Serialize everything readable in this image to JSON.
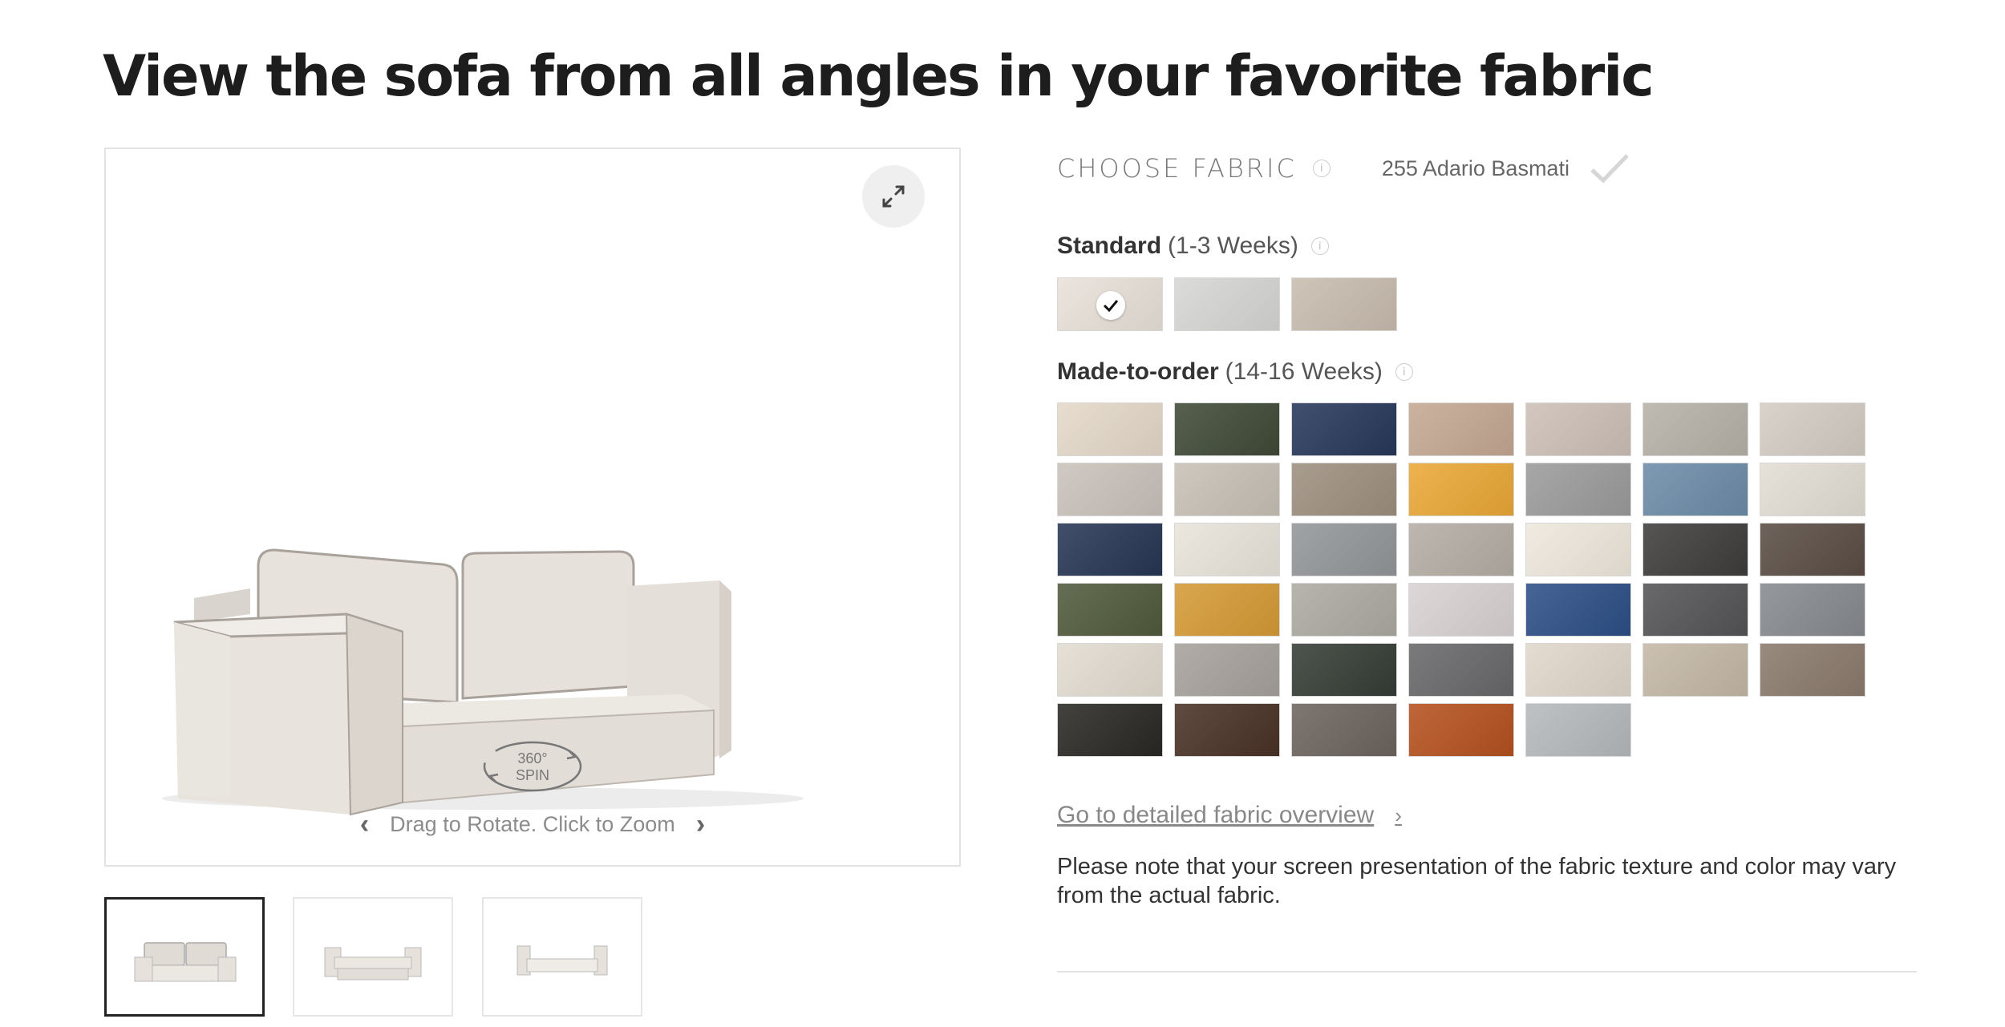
{
  "page": {
    "title": "View the sofa from all angles in your favorite fabric"
  },
  "viewer": {
    "hint": "Drag to Rotate. Click to Zoom",
    "spin_line1": "360°",
    "spin_line2": "SPIN"
  },
  "fabric": {
    "choose_label": "CHOOSE FABRIC",
    "selected_name": "255 Adario Basmati",
    "standard": {
      "name": "Standard",
      "lead_time": "(1-3 Weeks)",
      "swatches": [
        "#e8e1d9",
        "#d6d6d4",
        "#c8bcae"
      ],
      "selected_index": 0
    },
    "made_to_order": {
      "name": "Made-to-order",
      "lead_time": "(14-16 Weeks)",
      "swatches": [
        "#e4d8c8",
        "#3f4a36",
        "#27385a",
        "#c4a892",
        "#cdbfb6",
        "#b6b1a8",
        "#d4ccc3",
        "#c9c2bb",
        "#c7c0b6",
        "#9d8f7f",
        "#eaa836",
        "#9c9b9b",
        "#6d8ba7",
        "#e2ddd4",
        "#273654",
        "#e8e4db",
        "#939699",
        "#b4ada5",
        "#eee8dc",
        "#3f3d3b",
        "#5a4d45",
        "#505a3c",
        "#d59a35",
        "#adaaa2",
        "#d8d2d2",
        "#2d4f86",
        "#545456",
        "#868a8f",
        "#e2dcd0",
        "#a6a19b",
        "#343d35",
        "#68686a",
        "#e0d7ca",
        "#c4b8a6",
        "#8a7a6c",
        "#2a2824",
        "#4a3227",
        "#6c645e",
        "#b5511f",
        "#b5b9bc"
      ]
    },
    "overview_link": "Go to detailed fabric overview",
    "note": "Please note that your screen presentation of the fabric texture and color may vary from the actual fabric."
  },
  "icons": {
    "expand": "expand-arrows-icon",
    "check": "checkmark-icon",
    "info": "info-icon",
    "prev": "chevron-left-icon",
    "next": "chevron-right-icon"
  }
}
